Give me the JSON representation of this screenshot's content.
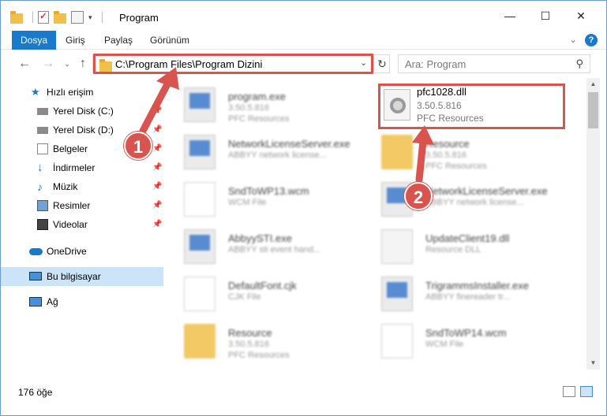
{
  "window": {
    "title": "Program",
    "controls": {
      "minimize": "—",
      "maximize": "☐",
      "close": "✕"
    }
  },
  "ribbon": {
    "tabs": [
      "Dosya",
      "Giriş",
      "Paylaş",
      "Görünüm"
    ],
    "help": "?"
  },
  "address": {
    "path": "C:\\Program Files\\Program Dizini",
    "search_placeholder": "Ara: Program"
  },
  "sidebar": {
    "items": [
      {
        "label": "Hızlı erişim",
        "icon": "star-icon"
      },
      {
        "label": "Yerel Disk (C:)",
        "icon": "drive-icon",
        "pinned": true
      },
      {
        "label": "Yerel Disk (D:)",
        "icon": "drive-icon",
        "pinned": true
      },
      {
        "label": "Belgeler",
        "icon": "documents-icon",
        "pinned": true
      },
      {
        "label": "İndirmeler",
        "icon": "download-icon",
        "pinned": true
      },
      {
        "label": "Müzik",
        "icon": "music-icon",
        "pinned": true
      },
      {
        "label": "Resimler",
        "icon": "pictures-icon",
        "pinned": true
      },
      {
        "label": "Videolar",
        "icon": "video-icon",
        "pinned": true
      },
      {
        "label": "OneDrive",
        "icon": "cloud-icon"
      },
      {
        "label": "Bu bilgisayar",
        "icon": "computer-icon",
        "selected": true
      },
      {
        "label": "Ağ",
        "icon": "network-icon"
      }
    ]
  },
  "files": {
    "left": [
      {
        "name": "program.exe",
        "line2": "3.50.5.816",
        "line3": "PFC Resources",
        "type": "exe"
      },
      {
        "name": "NetworkLicenseServer.exe",
        "line2": "ABBYY network license...",
        "line3": "",
        "type": "exe"
      },
      {
        "name": "SndToWP13.wcm",
        "line2": "WCM File",
        "line3": "",
        "type": "file"
      },
      {
        "name": "AbbyySTI.exe",
        "line2": "ABBYY sti event hand...",
        "line3": "",
        "type": "exe"
      },
      {
        "name": "DefaultFont.cjk",
        "line2": "CJK File",
        "line3": "",
        "type": "file"
      },
      {
        "name": "Resource",
        "line2": "3.50.5.816",
        "line3": "PFC Resources",
        "type": "folder"
      }
    ],
    "right": [
      {
        "name": "Resource",
        "line2": "3.50.5.816",
        "line3": "PFC Resources",
        "type": "folder"
      },
      {
        "name": "NetworkLicenseServer.exe",
        "line2": "ABBYY network license...",
        "line3": "",
        "type": "exe"
      },
      {
        "name": "UpdateClient19.dll",
        "line2": "Resource DLL",
        "line3": "",
        "type": "dll"
      },
      {
        "name": "TrigrammsInstaller.exe",
        "line2": "ABBYY finereader tr...",
        "line3": "",
        "type": "exe"
      },
      {
        "name": "SndToWP14.wcm",
        "line2": "WCM File",
        "line3": "",
        "type": "file"
      }
    ],
    "highlighted": {
      "name": "pfc1028.dll",
      "version": "3.50.5.816",
      "company": "PFC Resources"
    }
  },
  "status": {
    "count": "176 öğe"
  },
  "callouts": [
    "1",
    "2"
  ],
  "colors": {
    "accent": "#1979ca",
    "highlight": "#d9534f",
    "selected": "#cce4f7"
  }
}
